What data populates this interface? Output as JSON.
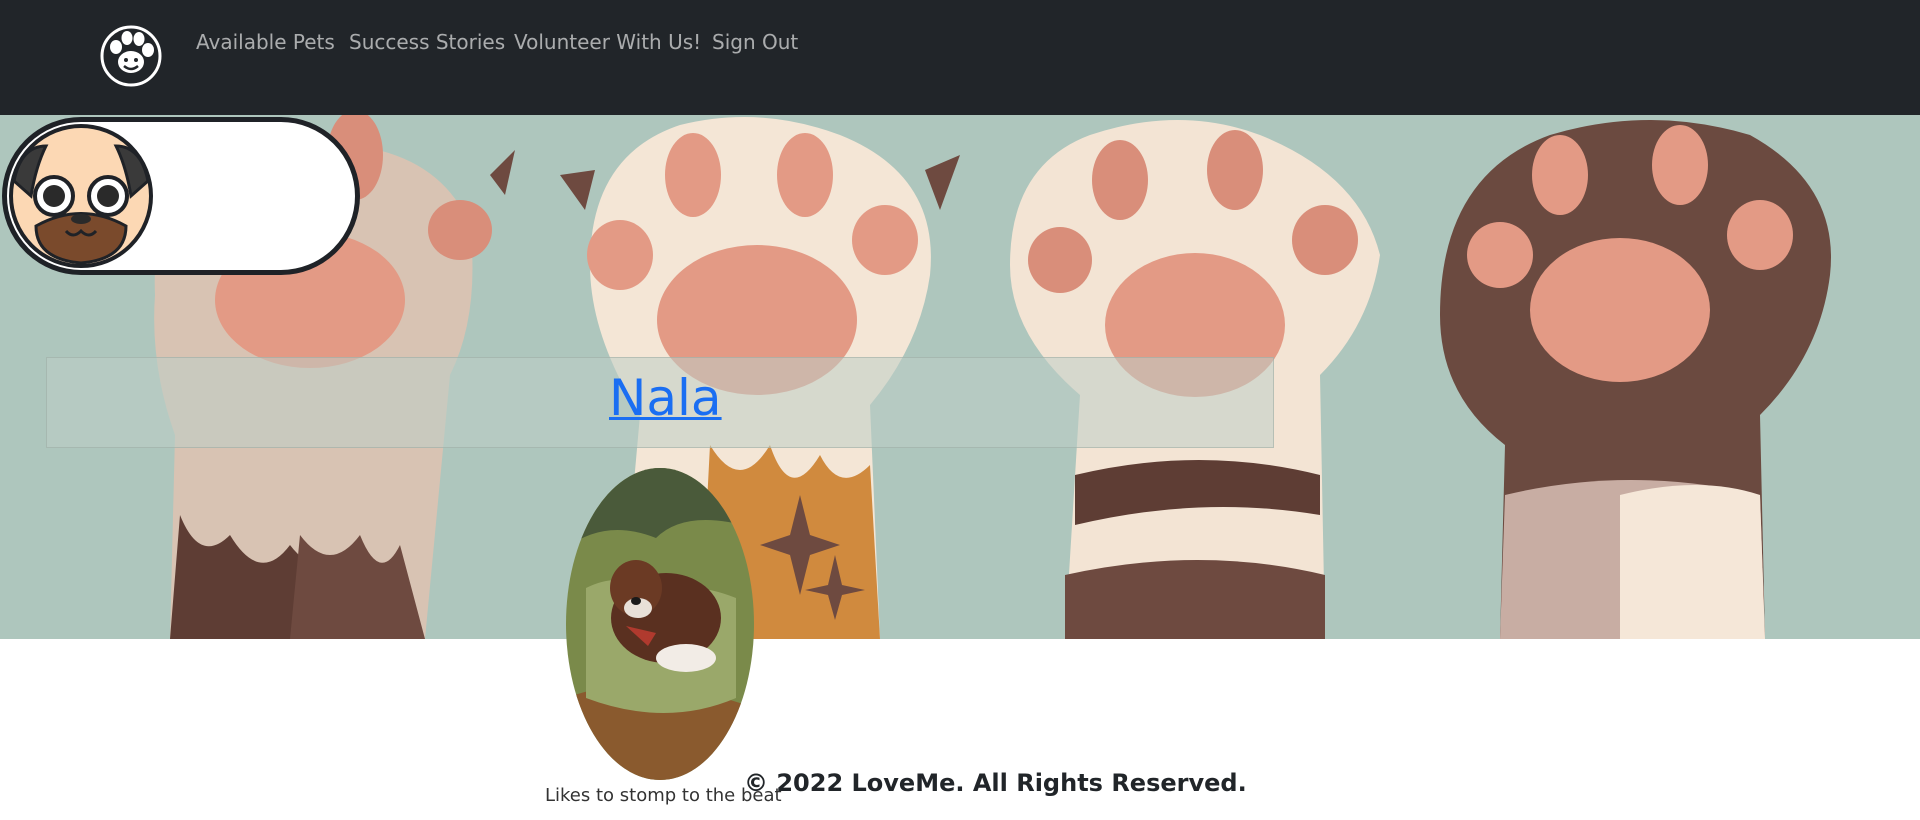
{
  "navbar": {
    "logo_icon": "paw-logo-icon",
    "links": [
      {
        "label": "Available Pets"
      },
      {
        "label": "Success Stories"
      },
      {
        "label": "Volunteer With Us!"
      },
      {
        "label": "Sign Out"
      }
    ],
    "background": "#212529",
    "link_color": "#9a9da0"
  },
  "hero": {
    "background_image": "cartoon-paws-banner",
    "background_color": "#aec6bd"
  },
  "mascot": {
    "icon": "pug-mascot-icon"
  },
  "pet": {
    "name": "Nala",
    "photo": "dog-photo",
    "description": "Likes to stomp to the beat"
  },
  "footer": {
    "copyright": "© 2022 LoveMe. All Rights Reserved."
  },
  "colors": {
    "link": "#1a6ef2",
    "outline": "#1f2227"
  }
}
